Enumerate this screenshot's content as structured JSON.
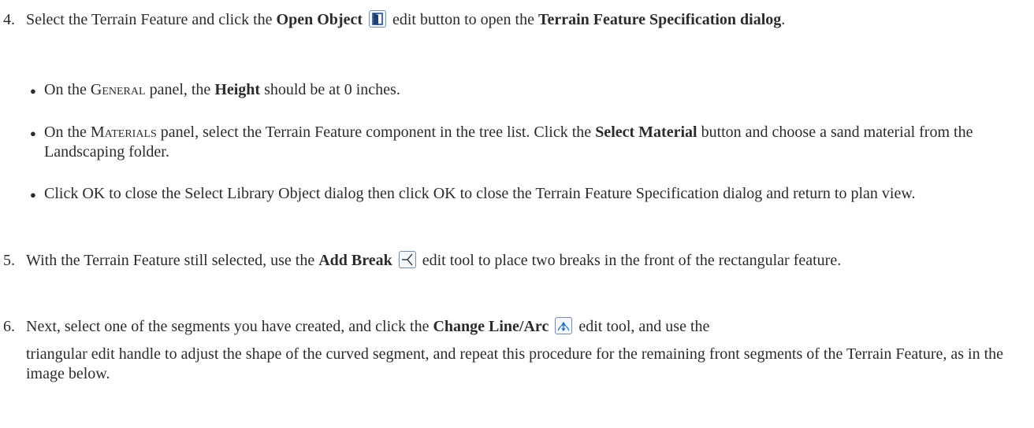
{
  "step4": {
    "number": "4.",
    "pre": "Select the Terrain Feature and click the ",
    "bold1": "Open Object",
    "mid": " edit button to open the ",
    "bold2": "Terrain Feature Specification dialog",
    "end": ".",
    "icon": "open-object-icon",
    "bullets": [
      {
        "pre": "On the ",
        "sc": "General",
        "mid": " panel, the ",
        "bold": "Height",
        "end": " should be at 0 inches."
      },
      {
        "pre": "On the ",
        "sc": "Materials",
        "mid": " panel, select the Terrain Feature component in the tree list. Click the ",
        "bold": "Select Material",
        "end": " button and choose a sand material from the Landscaping folder."
      },
      {
        "text": "Click OK to close the Select Library Object dialog then click OK to close the Terrain Feature Specification dialog and return to plan view."
      }
    ]
  },
  "step5": {
    "number": "5.",
    "pre": "With the Terrain Feature still selected, use the ",
    "bold": "Add Break",
    "post": " edit tool to place two breaks in the front of the rectangular feature.",
    "icon": "add-break-icon"
  },
  "step6": {
    "number": "6.",
    "pre": "Next, select one of the segments you have created, and click the ",
    "bold": "Change Line/Arc",
    "post": " edit tool, and use the",
    "cont": "triangular edit handle to adjust the shape of the curved segment, and repeat this procedure for the remaining front segments of the Terrain Feature, as in the image below.",
    "icon": "change-line-arc-icon"
  }
}
